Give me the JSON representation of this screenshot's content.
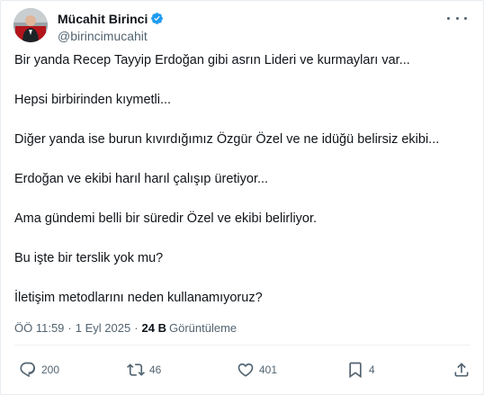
{
  "author": {
    "display_name": "Mücahit Birinci",
    "handle": "@birincimucahit",
    "verified_color": "#1d9bf0"
  },
  "icons": {
    "verified": "verified-badge-icon",
    "more": "more-options-icon",
    "reply": "reply-icon",
    "retweet": "retweet-icon",
    "like": "heart-icon",
    "bookmark": "bookmark-icon",
    "share": "share-icon"
  },
  "tweet": {
    "lines": [
      "Bir yanda Recep Tayyip Erdoğan gibi asrın Lideri ve kurmayları var...",
      "Hepsi birbirinden kıymetli...",
      "Diğer yanda ise burun kıvırdığımız Özgür Özel ve ne idüğü belirsiz ekibi...",
      "Erdoğan ve ekibi harıl harıl çalışıp üretiyor...",
      "Ama gündemi belli bir süredir Özel ve ekibi belirliyor.",
      "Bu işte bir terslik yok mu?",
      "İletişim metodlarını neden kullanamıyoruz?"
    ]
  },
  "meta": {
    "time": "ÖÖ 11:59",
    "separator": "·",
    "date": "1 Eyl 2025",
    "views_count": "24 B",
    "views_label": "Görüntüleme"
  },
  "actions": {
    "reply_count": "200",
    "retweet_count": "46",
    "like_count": "401",
    "bookmark_count": "4"
  }
}
